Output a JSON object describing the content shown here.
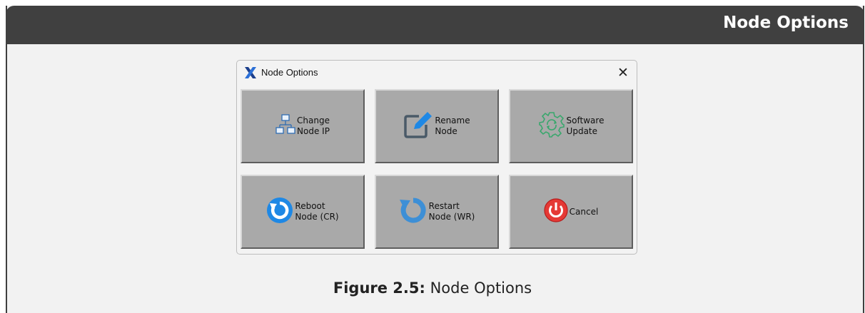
{
  "header": {
    "title": "Node Options"
  },
  "dialog": {
    "title": "Node Options",
    "close_label": "✕",
    "buttons": [
      {
        "label": "Change\nNode IP",
        "icon": "network-icon"
      },
      {
        "label": "Rename\nNode",
        "icon": "edit-icon"
      },
      {
        "label": "Software\nUpdate",
        "icon": "gear-refresh-icon"
      },
      {
        "label": "Reboot\nNode (CR)",
        "icon": "reboot-icon"
      },
      {
        "label": "Restart\nNode (WR)",
        "icon": "restart-icon"
      },
      {
        "label": "Cancel",
        "icon": "power-icon"
      }
    ]
  },
  "caption": {
    "label": "Figure 2.5:",
    "text": " Node Options"
  },
  "colors": {
    "header_bg": "#404040",
    "tile_bg": "#a9a9a9",
    "accent_blue": "#1e88e5",
    "gear_green": "#3aa76d",
    "power_red": "#e53935"
  }
}
